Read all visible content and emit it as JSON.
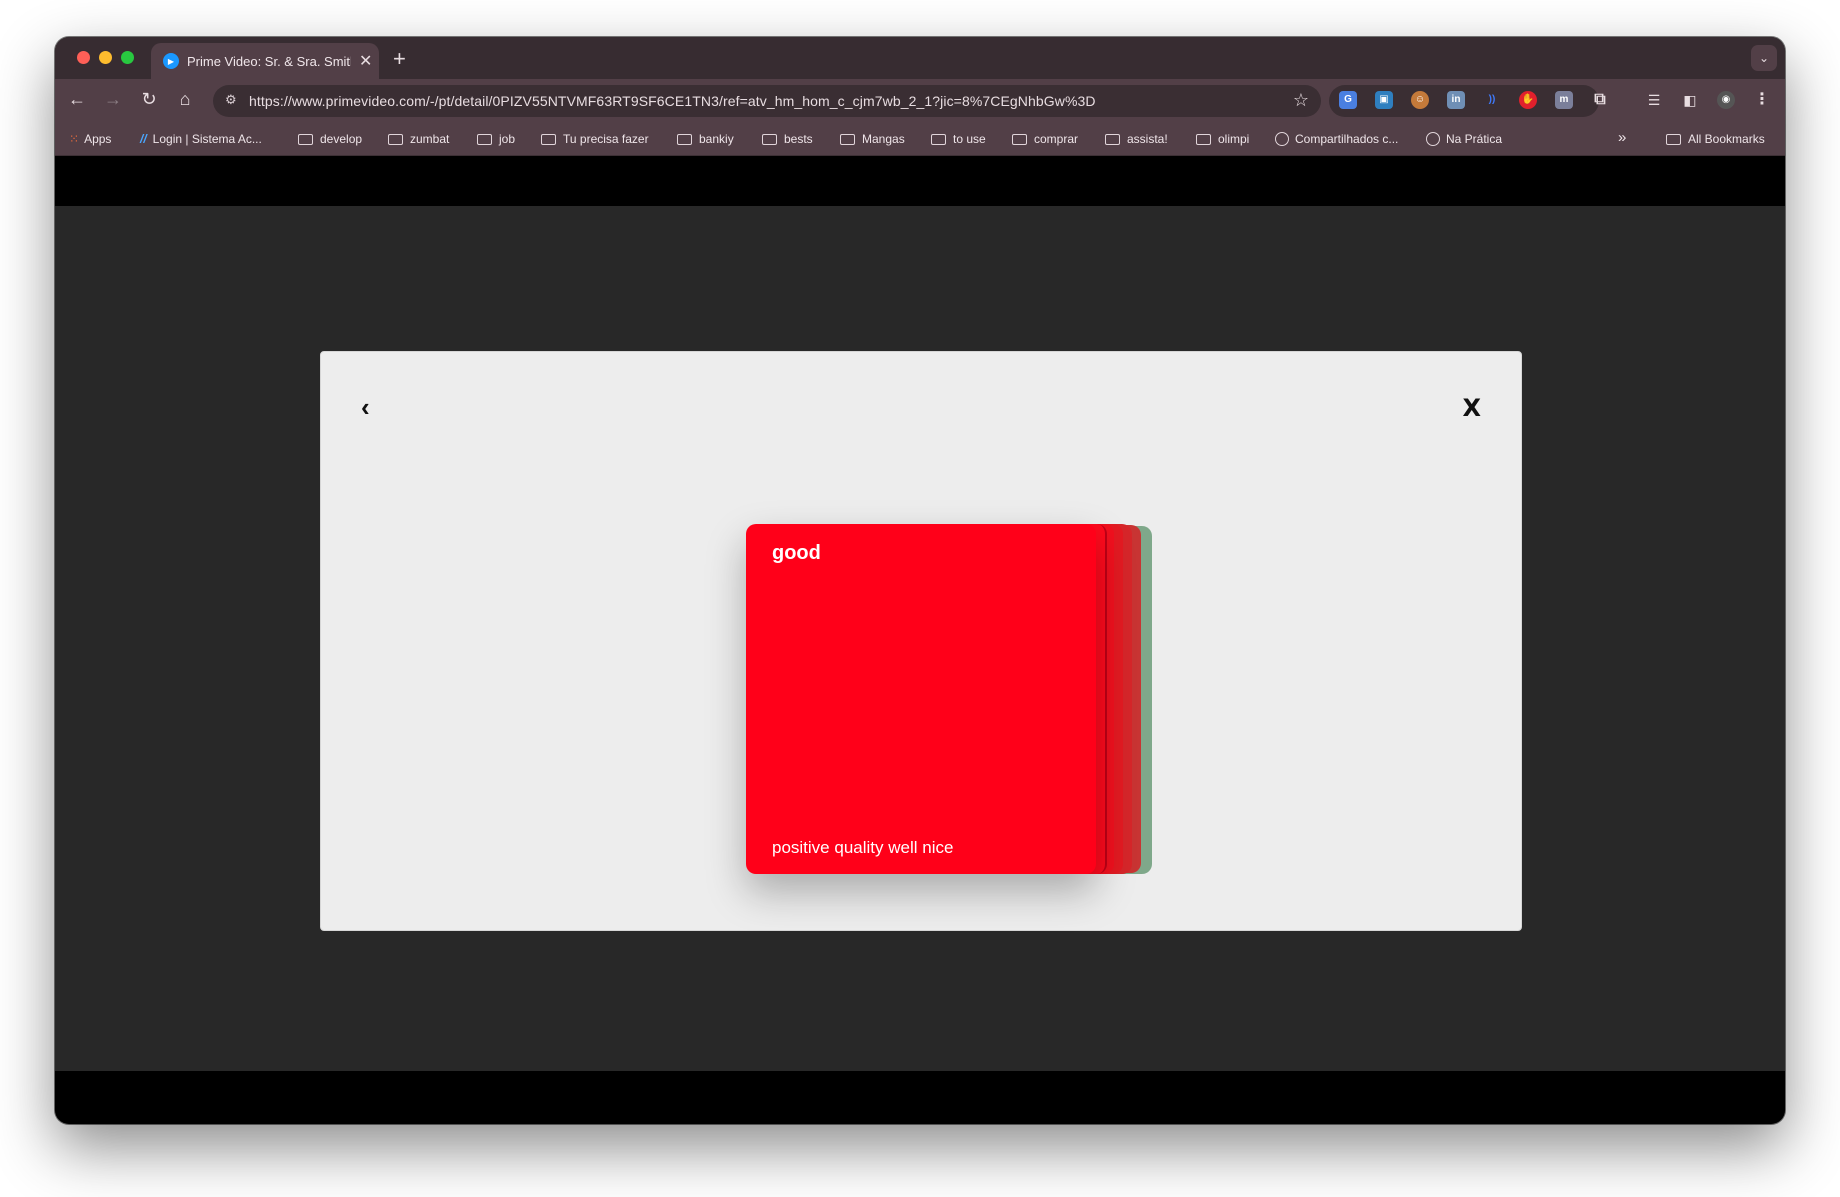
{
  "browser": {
    "tab_title": "Prime Video: Sr. & Sra. Smith",
    "tab_close": "✕",
    "new_tab": "+",
    "url": "https://www.primevideo.com/-/pt/detail/0PIZV55NTVMF63RT9SF6CE1TN3/ref=atv_hm_hom_c_cjm7wb_2_1?jic=8%7CEgNhbGw%3D",
    "bookmarks": [
      {
        "label": "Apps",
        "icon": "apps-grid-icon"
      },
      {
        "label": "Login | Sistema Ac...",
        "icon": "slash-logo-icon"
      },
      {
        "label": "develop",
        "icon": "folder-icon"
      },
      {
        "label": "zumbat",
        "icon": "folder-icon"
      },
      {
        "label": "job",
        "icon": "folder-icon"
      },
      {
        "label": "Tu precisa fazer",
        "icon": "folder-icon"
      },
      {
        "label": "bankiy",
        "icon": "folder-icon"
      },
      {
        "label": "bests",
        "icon": "folder-icon"
      },
      {
        "label": "Mangas",
        "icon": "folder-icon"
      },
      {
        "label": "to use",
        "icon": "folder-icon"
      },
      {
        "label": "comprar",
        "icon": "folder-icon"
      },
      {
        "label": "assista!",
        "icon": "folder-icon"
      },
      {
        "label": "olimpi",
        "icon": "folder-icon"
      },
      {
        "label": "Compartilhados c...",
        "icon": "globe-icon"
      },
      {
        "label": "Na Prática",
        "icon": "globe-icon"
      }
    ],
    "bookmarks_overflow": "»",
    "all_bookmarks": "All Bookmarks"
  },
  "modal": {
    "back_label": "‹",
    "close_label": "X",
    "card": {
      "word": "good",
      "synonyms": "positive quality well nice",
      "color": "#ff0019"
    },
    "stack_colors": [
      "#ff0019",
      "#f2101e",
      "#e41a22",
      "#d6262a",
      "#c83433",
      "#7fa88a"
    ]
  }
}
